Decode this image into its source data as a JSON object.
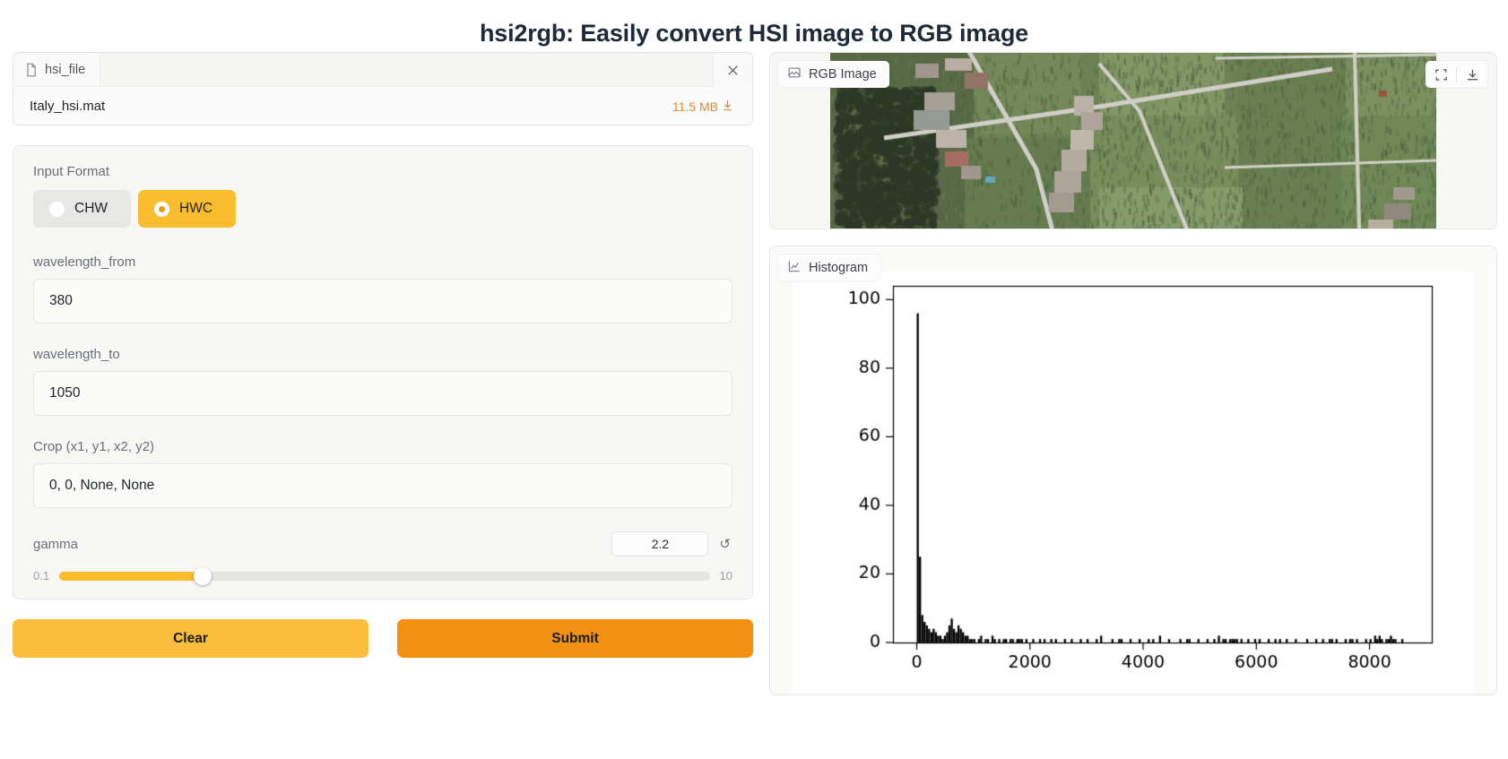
{
  "app": {
    "title": "hsi2rgb: Easily convert HSI image to RGB image"
  },
  "file_upload": {
    "tab_label": "hsi_file",
    "file_name": "Italy_hsi.mat",
    "file_size": "11.5 MB",
    "download_glyph": "↓",
    "close_glyph": "✕",
    "doc_icon": "document-icon"
  },
  "options": {
    "input_format": {
      "label": "Input Format",
      "options": [
        {
          "label": "CHW",
          "selected": false
        },
        {
          "label": "HWC",
          "selected": true
        }
      ]
    },
    "wavelength_from": {
      "label": "wavelength_from",
      "value": "380",
      "placeholder": "wavelength_from"
    },
    "wavelength_to": {
      "label": "wavelength_to",
      "value": "1050",
      "placeholder": "wavelength_to"
    },
    "crop": {
      "label": "Crop (x1, y1, x2, y2)",
      "value": "0, 0, None, None",
      "placeholder": "Crop (x1, y1, x2, y2)"
    },
    "gamma": {
      "label": "gamma",
      "value": "2.2",
      "min": "0.1",
      "max": "10",
      "fill_percent": 22,
      "reset_glyph": "↺"
    }
  },
  "actions": {
    "clear_label": "Clear",
    "submit_label": "Submit",
    "clear_color": "#fabd3c",
    "submit_color": "#f29111"
  },
  "outputs": {
    "rgb_image": {
      "tab_label": "RGB Image",
      "icon": "image-icon",
      "tools": [
        {
          "name": "fullscreen-icon"
        },
        {
          "name": "download-icon"
        }
      ]
    },
    "histogram": {
      "tab_label": "Histogram",
      "icon": "chart-line-icon"
    }
  },
  "chart_data": {
    "type": "bar",
    "title": "Histogram",
    "xlabel": "",
    "ylabel": "",
    "xlim": [
      -420,
      9100
    ],
    "ylim": [
      0,
      104
    ],
    "xticks": [
      0,
      2000,
      4000,
      6000,
      8000
    ],
    "yticks": [
      0,
      20,
      40,
      60,
      80,
      100
    ],
    "grid": false,
    "legend": null,
    "bar_color": "#000000",
    "bin_width": 40,
    "x": [
      0,
      40,
      80,
      120,
      160,
      200,
      240,
      280,
      320,
      360,
      400,
      440,
      480,
      520,
      560,
      600,
      640,
      680,
      720,
      760,
      800,
      840,
      880,
      920,
      960,
      1000,
      1040,
      1080,
      1120,
      1160,
      1200,
      1240,
      1280,
      1320,
      1360,
      1400,
      1440,
      1480,
      1520,
      1560,
      1600,
      1640,
      1680,
      1720,
      1760,
      1800,
      1840,
      1880,
      1920,
      1960,
      2000,
      2040,
      2080,
      2120,
      2160,
      2200,
      2240,
      2280,
      2320,
      2360,
      2400,
      2440,
      2480,
      2520,
      2560,
      2600,
      2640,
      2680,
      2720,
      2760,
      2800,
      2840,
      2880,
      2920,
      2960,
      3000,
      3040,
      3080,
      3120,
      3160,
      3200,
      3240,
      3280,
      3320,
      3360,
      3400,
      3440,
      3480,
      3520,
      3560,
      3600,
      3640,
      3680,
      3720,
      3760,
      3800,
      3840,
      3880,
      3920,
      3960,
      4000,
      4040,
      4080,
      4120,
      4160,
      4200,
      4240,
      4280,
      4320,
      4360,
      4400,
      4440,
      4480,
      4520,
      4560,
      4600,
      4640,
      4680,
      4720,
      4760,
      4800,
      4840,
      4880,
      4920,
      4960,
      5000,
      5040,
      5080,
      5120,
      5160,
      5200,
      5240,
      5280,
      5320,
      5360,
      5400,
      5440,
      5480,
      5520,
      5560,
      5600,
      5640,
      5680,
      5720,
      5760,
      5800,
      5840,
      5880,
      5920,
      5960,
      6000,
      6040,
      6080,
      6120,
      6160,
      6200,
      6240,
      6280,
      6320,
      6360,
      6400,
      6440,
      6480,
      6520,
      6560,
      6600,
      6640,
      6680,
      6720,
      6760,
      6800,
      6840,
      6880,
      6920,
      6960,
      7000,
      7040,
      7080,
      7120,
      7160,
      7200,
      7240,
      7280,
      7320,
      7360,
      7400,
      7440,
      7480,
      7520,
      7560,
      7600,
      7640,
      7680,
      7720,
      7760,
      7800,
      7840,
      7880,
      7920,
      7960,
      8000,
      8040,
      8080,
      8120,
      8160,
      8200,
      8240,
      8280,
      8320,
      8360,
      8400,
      8440,
      8480,
      8520,
      8560,
      8600,
      8640,
      8680,
      8720,
      8760,
      8800
    ],
    "values": [
      96,
      25,
      8,
      6,
      5,
      4,
      3,
      4,
      3,
      2,
      2,
      1,
      2,
      3,
      5,
      7,
      4,
      3,
      5,
      4,
      3,
      2,
      2,
      1,
      1,
      1,
      0,
      1,
      2,
      0,
      1,
      1,
      0,
      2,
      1,
      0,
      1,
      0,
      1,
      1,
      0,
      1,
      1,
      0,
      1,
      1,
      1,
      0,
      1,
      0,
      0,
      1,
      0,
      0,
      1,
      0,
      1,
      0,
      0,
      1,
      0,
      1,
      0,
      0,
      0,
      1,
      0,
      0,
      1,
      0,
      0,
      0,
      1,
      0,
      0,
      1,
      0,
      0,
      0,
      1,
      0,
      2,
      0,
      0,
      0,
      0,
      1,
      0,
      0,
      1,
      1,
      0,
      0,
      0,
      1,
      0,
      0,
      0,
      1,
      0,
      0,
      0,
      1,
      0,
      1,
      0,
      0,
      2,
      0,
      0,
      0,
      1,
      0,
      0,
      0,
      0,
      1,
      0,
      0,
      1,
      1,
      0,
      0,
      0,
      1,
      0,
      0,
      0,
      1,
      0,
      0,
      1,
      0,
      2,
      0,
      1,
      1,
      0,
      1,
      1,
      1,
      1,
      0,
      1,
      0,
      0,
      1,
      0,
      0,
      1,
      0,
      1,
      0,
      0,
      0,
      1,
      0,
      0,
      1,
      0,
      1,
      0,
      0,
      1,
      0,
      0,
      0,
      1,
      0,
      0,
      0,
      0,
      1,
      0,
      0,
      0,
      1,
      0,
      0,
      1,
      0,
      0,
      1,
      1,
      0,
      1,
      0,
      0,
      0,
      1,
      0,
      1,
      1,
      0,
      1,
      0,
      0,
      0,
      1,
      0,
      1,
      0,
      2,
      1,
      2,
      1,
      0,
      1,
      1,
      2,
      1,
      1,
      0,
      0,
      1,
      0,
      0,
      0,
      0,
      0
    ]
  }
}
